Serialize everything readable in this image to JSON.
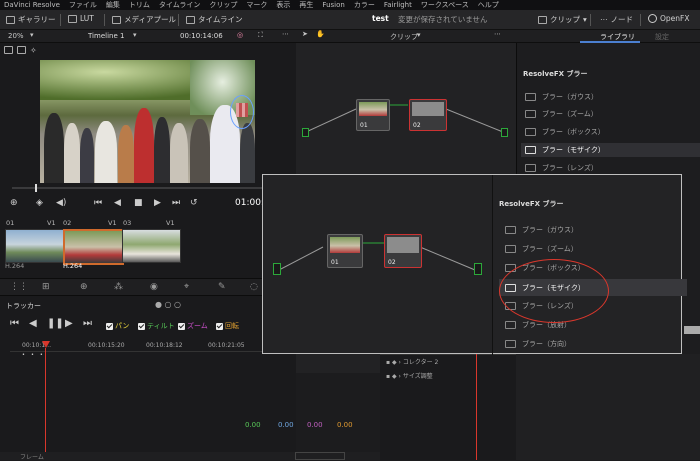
{
  "menubar": {
    "items": [
      "DaVinci Resolve",
      "ファイル",
      "編集",
      "トリム",
      "タイムライン",
      "クリップ",
      "マーク",
      "表示",
      "再生",
      "Fusion",
      "カラー",
      "Fairlight",
      "ワークスペース",
      "ヘルプ"
    ]
  },
  "toolbar": {
    "gallery": "ギャラリー",
    "lut": "LUT",
    "media_pool": "メディアプール",
    "timeline": "タイムライン",
    "project_name": "test",
    "status": "変更が保存されていません",
    "clip": "クリップ",
    "node": "ノード",
    "openfx": "OpenFX"
  },
  "subbar": {
    "zoom": "20%",
    "timeline_name": "Timeline 1",
    "timecode": "00:10:14:06",
    "node_mode": "クリップ",
    "tab_library": "ライブラリ",
    "tab_settings": "設定"
  },
  "viewer": {
    "transport_timecode": "01:00:"
  },
  "clips": [
    {
      "num": "01",
      "track": "V1",
      "codec": "H.264"
    },
    {
      "num": "02",
      "track": "V1",
      "codec": "H.264"
    },
    {
      "num": "03",
      "track": "V1",
      "codec": ""
    }
  ],
  "tracker": {
    "title": "トラッカー",
    "options": [
      "パン",
      "ティルト",
      "ズーム",
      "回転"
    ],
    "option_colors": [
      "#e8d43c",
      "#57c857",
      "#d050d0",
      "#e0a030"
    ],
    "ruler": [
      "00:10:1…",
      "00:10:15:20",
      "00:10:18:12",
      "00:10:21:05"
    ],
    "values": [
      "0.00",
      "0.00",
      "0.00",
      "0.00"
    ],
    "value_colors": [
      "#58c858",
      "#6fa6e0",
      "#c060c0",
      "#e09a30"
    ],
    "footer": "フレーム"
  },
  "nodes": [
    {
      "label": "01"
    },
    {
      "label": "02"
    }
  ],
  "library": {
    "header": "ResolveFX ブラー",
    "items": [
      "ブラー（ガウス）",
      "ブラー（ズーム）",
      "ブラー（ボックス）",
      "ブラー（モザイク）",
      "ブラー（レンズ）"
    ],
    "selected": 3
  },
  "zoom_panel": {
    "header": "ResolveFX ブラー",
    "items": [
      "ブラー（ガウス）",
      "ブラー（ズーム）",
      "ブラー（ボックス）",
      "ブラー（モザイク）",
      "ブラー（レンズ）",
      "ブラー（放射）",
      "ブラー（方向）"
    ],
    "selected": 3,
    "node_labels": [
      "01",
      "02"
    ]
  },
  "keyframe_rows": [
    "コレクター 2",
    "サイズ調整"
  ],
  "accent": "#d8372c"
}
